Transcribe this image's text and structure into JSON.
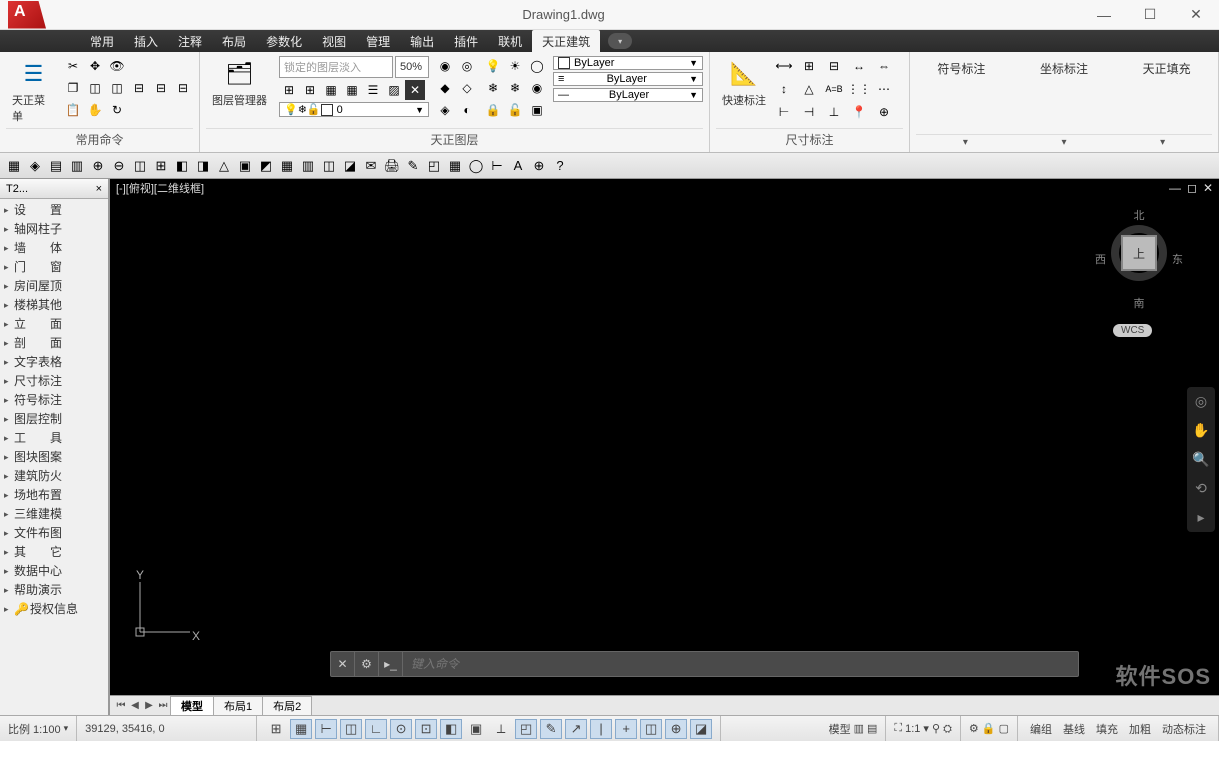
{
  "title": "Drawing1.dwg",
  "menus": [
    "常用",
    "插入",
    "注释",
    "布局",
    "参数化",
    "视图",
    "管理",
    "输出",
    "插件",
    "联机",
    "天正建筑"
  ],
  "active_menu": 10,
  "ribbon": {
    "panel1": {
      "label": "天正菜单",
      "title": "常用命令"
    },
    "panel2": {
      "label": "图层管理器",
      "title": "天正图层",
      "locked_input": "锁定的图层淡入",
      "pct": "50%",
      "layer0": "0",
      "bylayer": "ByLayer"
    },
    "panel3": {
      "label": "快速标注",
      "title": "尺寸标注"
    },
    "dd_extra": [
      "符号标注",
      "坐标标注",
      "天正填充"
    ]
  },
  "side": {
    "header": "T2...",
    "items": [
      "设　　置",
      "轴网柱子",
      "墙　　体",
      "门　　窗",
      "房间屋顶",
      "楼梯其他",
      "立　　面",
      "剖　　面",
      "文字表格",
      "尺寸标注",
      "符号标注",
      "图层控制",
      "工　　具",
      "图块图案",
      "建筑防火",
      "场地布置",
      "三维建模",
      "文件布图",
      "其　　它",
      "数据中心",
      "帮助演示",
      "授权信息"
    ]
  },
  "canvas": {
    "viewport_label": "[-][俯视][二维线框]",
    "cube": {
      "n": "北",
      "s": "南",
      "e": "东",
      "w": "西",
      "top": "上",
      "wcs": "WCS"
    },
    "cmd_placeholder": "键入命令",
    "ucs": {
      "x": "X",
      "y": "Y"
    }
  },
  "tabs": [
    "模型",
    "布局1",
    "布局2"
  ],
  "active_tab": 0,
  "status": {
    "scale": "比例 1:100",
    "coords": "39129, 35416, 0",
    "model": "模型",
    "ann": "1:1",
    "labels": [
      "编组",
      "基线",
      "填充",
      "加粗",
      "动态标注"
    ]
  },
  "watermark": "软件SOS"
}
